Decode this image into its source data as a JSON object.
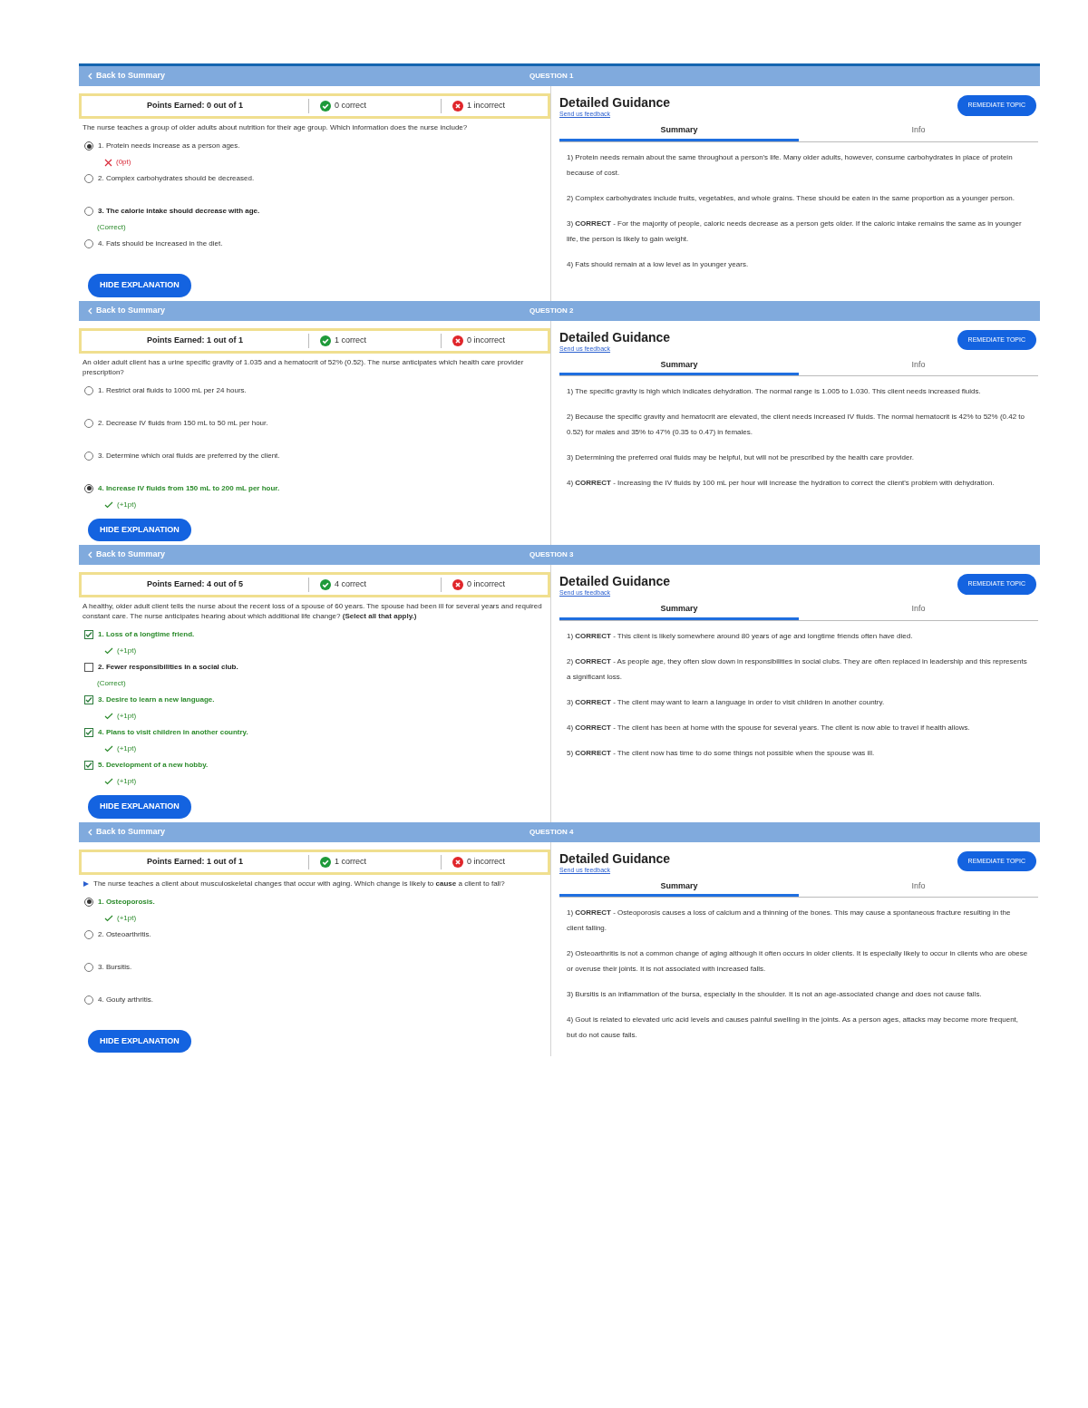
{
  "questions": [
    {
      "back": "Back to Summary",
      "title": "QUESTION 1",
      "flagged": false,
      "points": {
        "earned": "Points Earned: 0 out of 1",
        "correct": "0 correct",
        "incorrect": "1 incorrect"
      },
      "stem": "The nurse teaches a group of older adults about nutrition for their age group. Which information does the nurse include?",
      "kind": "radio",
      "options": [
        {
          "label": "1. Protein needs increase as a person ages.",
          "selected": true,
          "kind": "wrong",
          "feedback": "(0pt)"
        },
        {
          "label": "2. Complex carbohydrates should be decreased.",
          "selected": false,
          "kind": "none"
        },
        {
          "label": "3. The calorie intake should decrease with age.",
          "selected": false,
          "kind": "missed",
          "feedback": "(Correct)"
        },
        {
          "label": "4. Fats should be increased in the diet.",
          "selected": false,
          "kind": "none"
        }
      ],
      "hide_button": "HIDE EXPLANATION",
      "guidance": {
        "title": "Detailed Guidance",
        "feedback_link": "Send us feedback",
        "remediate_button": "REMEDIATE TOPIC",
        "tabs": [
          {
            "label": "Summary",
            "selected": true
          },
          {
            "label": "Info",
            "selected": false
          }
        ],
        "explanations": [
          "1) Protein needs remain about the same throughout a person's life. Many older adults, however, consume carbohydrates in place of protein because of cost.",
          "2) Complex carbohydrates include fruits, vegetables, and whole grains. These should be eaten in the same proportion as a younger person.",
          "3) **CORRECT** - For the majority of people, caloric needs decrease as a person gets older. If the caloric intake remains the same as in younger life, the person is likely to gain weight.",
          "4) Fats should remain at a low level as in younger years."
        ]
      }
    },
    {
      "back": "Back to Summary",
      "title": "QUESTION 2",
      "flagged": false,
      "points": {
        "earned": "Points Earned: 1 out of 1",
        "correct": "1 correct",
        "incorrect": "0 incorrect"
      },
      "stem": "An older adult client has a urine specific gravity of 1.035 and a hematocrit of 52% (0.52). The nurse anticipates which health care provider prescription?",
      "kind": "radio",
      "options": [
        {
          "label": "1. Restrict oral fluids to 1000 mL per 24 hours.",
          "selected": false,
          "kind": "none"
        },
        {
          "label": "2. Decrease IV fluids from 150 mL to 50 mL per hour.",
          "selected": false,
          "kind": "none"
        },
        {
          "label": "3. Determine which oral fluids are preferred by the client.",
          "selected": false,
          "kind": "none"
        },
        {
          "label": "4. Increase IV fluids from 150 mL to 200 mL per hour.",
          "selected": true,
          "kind": "earned",
          "feedback": "(+1pt)"
        }
      ],
      "hide_button": "HIDE EXPLANATION",
      "guidance": {
        "title": "Detailed Guidance",
        "feedback_link": "Send us feedback",
        "remediate_button": "REMEDIATE TOPIC",
        "tabs": [
          {
            "label": "Summary",
            "selected": true
          },
          {
            "label": "Info",
            "selected": false
          }
        ],
        "explanations": [
          "1) The specific gravity is high which indicates dehydration. The normal range is 1.005 to 1.030. This client needs increased fluids.",
          "2) Because the specific gravity and hematocrit are elevated, the client needs increased IV fluids. The normal hematocrit is 42% to 52% (0.42 to 0.52) for males and 35% to 47% (0.35 to 0.47) in females.",
          "3) Determining the preferred oral fluids may be helpful, but will not be prescribed by the health care provider.",
          "4) **CORRECT** - Increasing the IV fluids by 100 mL per hour will increase the hydration to correct the client's problem with dehydration."
        ]
      }
    },
    {
      "back": "Back to Summary",
      "title": "QUESTION 3",
      "flagged": false,
      "points": {
        "earned": "Points Earned: 4 out of 5",
        "correct": "4 correct",
        "incorrect": "0 incorrect"
      },
      "stem": "A healthy, older adult client tells the nurse about the recent loss of a spouse of 60 years. The spouse had been ill for several years and required constant care. The nurse anticipates hearing about which additional life change? **(Select all that apply.)**",
      "kind": "checkbox",
      "options": [
        {
          "label": "1. Loss of a longtime friend.",
          "selected": true,
          "kind": "earned",
          "feedback": "(+1pt)"
        },
        {
          "label": "2. Fewer responsibilities in a social club.",
          "selected": false,
          "kind": "missed",
          "feedback": "(Correct)"
        },
        {
          "label": "3. Desire to learn a new language.",
          "selected": true,
          "kind": "earned",
          "feedback": "(+1pt)"
        },
        {
          "label": "4. Plans to visit children in another country.",
          "selected": true,
          "kind": "earned",
          "feedback": "(+1pt)"
        },
        {
          "label": "5. Development of a new hobby.",
          "selected": true,
          "kind": "earned",
          "feedback": "(+1pt)"
        }
      ],
      "hide_button": "HIDE EXPLANATION",
      "guidance": {
        "title": "Detailed Guidance",
        "feedback_link": "Send us feedback",
        "remediate_button": "REMEDIATE TOPIC",
        "tabs": [
          {
            "label": "Summary",
            "selected": true
          },
          {
            "label": "Info",
            "selected": false
          }
        ],
        "explanations": [
          "1) **CORRECT** - This client is likely somewhere around 80 years of age and longtime friends often have died.",
          "2) **CORRECT** - As people age, they often slow down in responsibilities in social clubs. They are often replaced in leadership and this represents a significant loss.",
          "3) **CORRECT** - The client may want to learn a language in order to visit children in another country.",
          "4) **CORRECT** - The client has been at home with the spouse for several years. The client is now able to travel if health allows.",
          "5) **CORRECT** - The client now has time to do some things not possible when the spouse was ill."
        ]
      }
    },
    {
      "back": "Back to Summary",
      "title": "QUESTION 4",
      "flagged": true,
      "points": {
        "earned": "Points Earned: 1 out of 1",
        "correct": "1 correct",
        "incorrect": "0 incorrect"
      },
      "stem": "The nurse teaches a client about musculoskeletal changes that occur with aging. Which change is likely to **cause** a client to fall?",
      "kind": "radio",
      "options": [
        {
          "label": "1. Osteoporosis.",
          "selected": true,
          "kind": "earned",
          "feedback": "(+1pt)"
        },
        {
          "label": "2. Osteoarthritis.",
          "selected": false,
          "kind": "none"
        },
        {
          "label": "3. Bursitis.",
          "selected": false,
          "kind": "none"
        },
        {
          "label": "4. Gouty arthritis.",
          "selected": false,
          "kind": "none"
        }
      ],
      "hide_button": "HIDE EXPLANATION",
      "guidance": {
        "title": "Detailed Guidance",
        "feedback_link": "Send us feedback",
        "remediate_button": "REMEDIATE TOPIC",
        "tabs": [
          {
            "label": "Summary",
            "selected": true
          },
          {
            "label": "Info",
            "selected": false
          }
        ],
        "explanations": [
          "1) **CORRECT** - Osteoporosis causes a loss of calcium and a thinning of the bones. This may cause a spontaneous fracture resulting in the client falling.",
          "2) Osteoarthritis is not a common change of aging although it often occurs in older clients. It is especially likely to occur in clients who are obese or overuse their joints. It is not associated with increased falls.",
          "3) Bursitis is an inflammation of the bursa, especially in the shoulder. It is not an age-associated change and does not cause falls.",
          "4) Gout is related to elevated uric acid levels and causes painful swelling in the joints. As a person ages, attacks may become more frequent, but do not cause falls."
        ]
      }
    }
  ]
}
